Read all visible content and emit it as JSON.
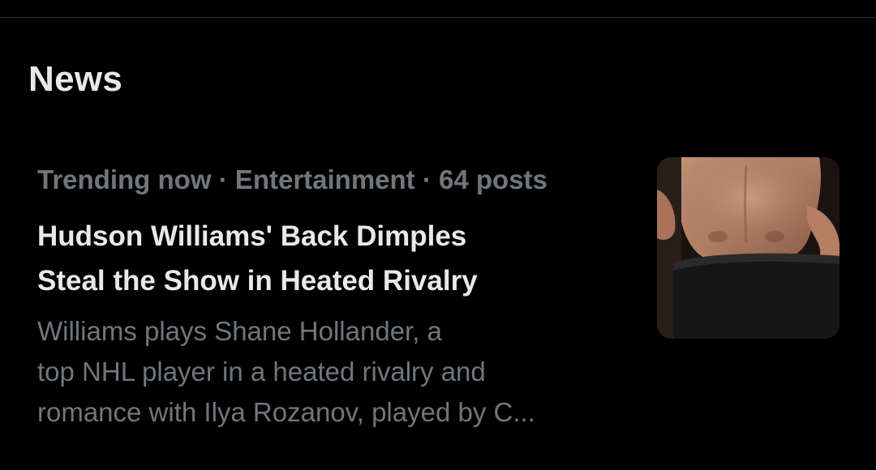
{
  "section": {
    "title": "News"
  },
  "news_item": {
    "meta": "Trending now · Entertainment · 64 posts",
    "headline_lines": [
      "Hudson Williams' Back Dimples",
      "Steal the Show in Heated Rivalry"
    ],
    "summary_lines": [
      "Williams plays Shane Hollander, a",
      "top NHL player in a heated rivalry and",
      "romance with Ilya Rozanov, played by C..."
    ],
    "thumbnail_icon": "news-thumbnail-image"
  },
  "colors": {
    "background": "#000000",
    "primary_text": "#e7e9ea",
    "secondary_text": "#71767b",
    "divider": "#2f3336"
  }
}
